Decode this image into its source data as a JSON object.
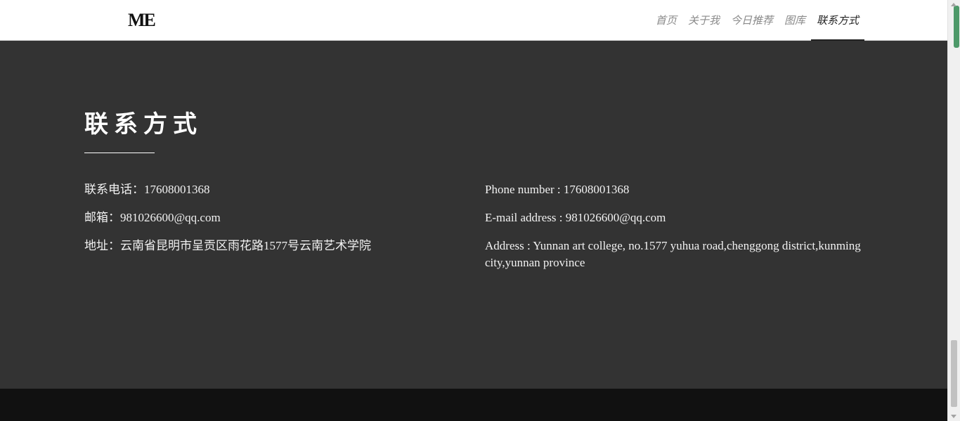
{
  "header": {
    "logo": "ME",
    "nav": [
      {
        "label": "首页"
      },
      {
        "label": "关于我"
      },
      {
        "label": "今日推荐"
      },
      {
        "label": "图库"
      },
      {
        "label": "联系方式"
      }
    ],
    "active_nav_index": 4
  },
  "contact": {
    "title": "联系方式",
    "cn": {
      "phone": "联系电话：17608001368",
      "email": "邮箱：981026600@qq.com",
      "address": "地址：云南省昆明市呈贡区雨花路1577号云南艺术学院"
    },
    "en": {
      "phone": "Phone number : 17608001368",
      "email": "E-mail address : 981026600@qq.com",
      "address": "Address : Yunnan art college, no.1577 yuhua road,chenggong district,kunming city,yunnan province"
    }
  },
  "colors": {
    "section_bg": "#333333",
    "footer_bg": "#111111",
    "nav_bg": "#ffffff",
    "scroll_accent": "#3b8f5a"
  }
}
